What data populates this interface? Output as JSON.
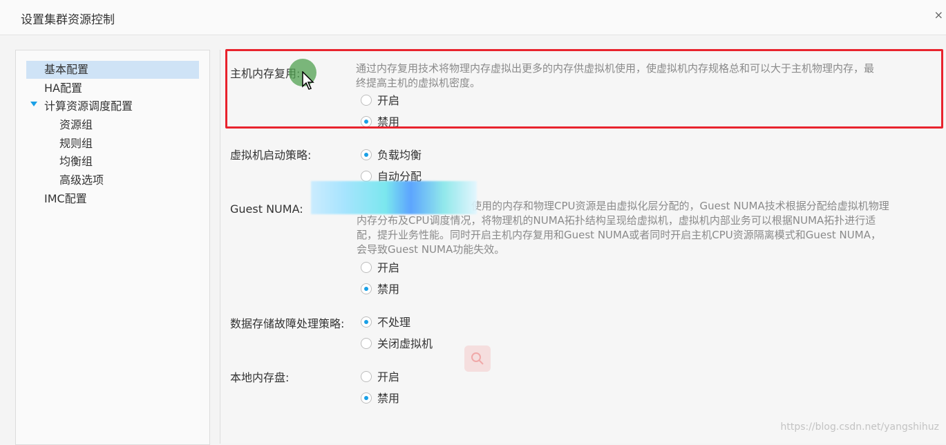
{
  "window": {
    "title": "设置集群资源控制",
    "close_glyph": "×"
  },
  "sidebar": {
    "items": [
      {
        "label": "基本配置"
      },
      {
        "label": "HA配置"
      },
      {
        "label": "计算资源调度配置"
      },
      {
        "label": "资源组"
      },
      {
        "label": "规则组"
      },
      {
        "label": "均衡组"
      },
      {
        "label": "高级选项"
      },
      {
        "label": "IMC配置"
      }
    ]
  },
  "settings": {
    "memory_reuse": {
      "label": "主机内存复用:",
      "desc_line1": "通过内存复用技术将物理内存虚拟出更多的内存供虚拟机使用，使虚拟机内存规格总和可以大于主机物理内存，最",
      "desc_line2": "终提高主机的虚拟机密度。",
      "options": [
        "开启",
        "禁用"
      ],
      "selected": "禁用"
    },
    "vm_start_policy": {
      "label": "虚拟机启动策略:",
      "options": [
        "负载均衡",
        "自动分配"
      ],
      "selected": "负载均衡"
    },
    "guest_numa": {
      "label": "Guest NUMA:",
      "desc_line1": "使用的内存和物理CPU资源是由虚拟化层分配的，Guest NUMA技术根据分配给虚拟机物理",
      "desc_line2": "内存分布及CPU调度情况，将物理机的NUMA拓扑结构呈现给虚拟机，虚拟机内部业务可以根据NUMA拓扑进行适",
      "desc_line3": "配，提升业务性能。同时开启主机内存复用和Guest NUMA或者同时开启主机CPU资源隔离模式和Guest NUMA，",
      "desc_line4": "会导致Guest NUMA功能失效。",
      "options": [
        "开启",
        "禁用"
      ],
      "selected": "禁用"
    },
    "storage_fault_policy": {
      "label": "数据存储故障处理策略:",
      "options": [
        "不处理",
        "关闭虚拟机"
      ],
      "selected": "不处理"
    },
    "local_memory_disk": {
      "label": "本地内存盘:",
      "options": [
        "开启",
        "禁用"
      ],
      "selected": "禁用"
    }
  },
  "colors": {
    "accent": "#1aa0e6",
    "highlight_border": "#e8232d",
    "selected_bg": "#cfe3f6"
  },
  "watermark": "https://blog.csdn.net/yangshihuz"
}
